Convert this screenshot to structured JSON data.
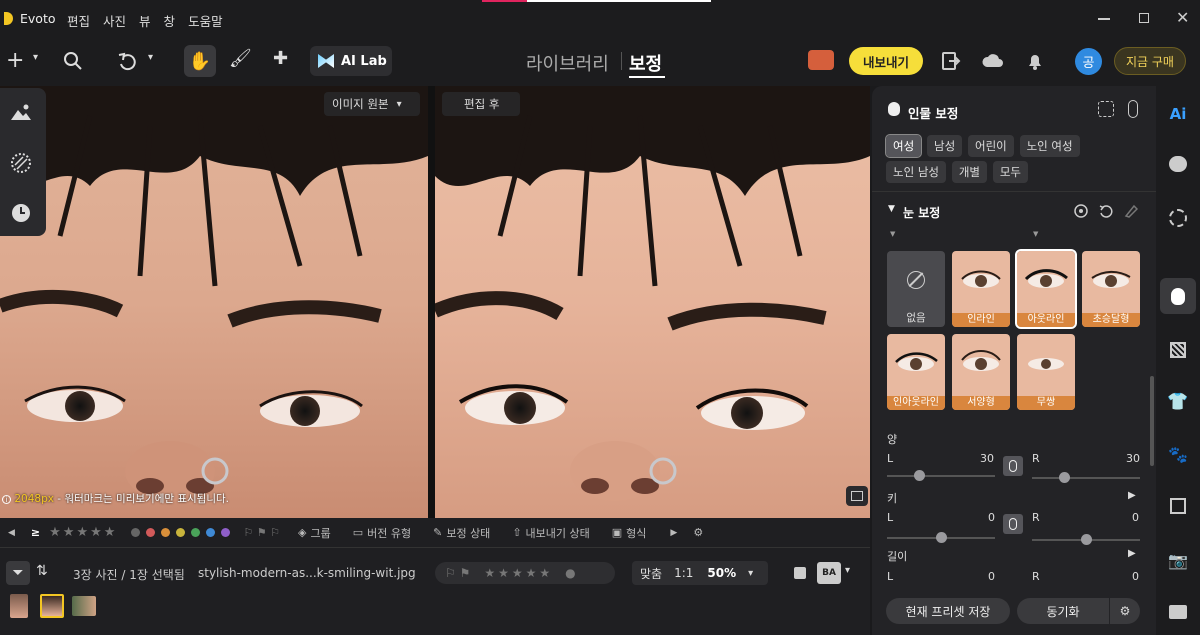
{
  "app": {
    "name": "Evoto",
    "menu": [
      "편집",
      "사진",
      "뷰",
      "창",
      "도움말"
    ]
  },
  "toolbar": {
    "ai_lab": "AI Lab",
    "tab_library": "라이브러리",
    "tab_edit": "보정",
    "export": "내보내기",
    "avatar": "공",
    "buy": "지금 구매"
  },
  "canvas": {
    "original_label": "이미지 원본",
    "after_label": "편집 후",
    "watermark_px": "2048px",
    "watermark_text": " - 워터마크는 미리보기에만 표시됩니다."
  },
  "filterbar": {
    "group": "그룹",
    "version": "버전 유형",
    "status": "보정 상태",
    "export_status": "내보내기 상태",
    "format": "형식",
    "colors": [
      "#d25a5a",
      "#d98f3a",
      "#c9b43c",
      "#4aa35a",
      "#3f8ad6",
      "#8f5fc9"
    ]
  },
  "statusbar": {
    "count": "3장 사진 / 1장 선택됨",
    "filename": "stylish-modern-as...k-smiling-wit.jpg",
    "fit": "맞춤",
    "ratio": "1:1",
    "zoom": "50%"
  },
  "panel": {
    "title": "인물 보정",
    "chips": [
      "여성",
      "남성",
      "어린이",
      "노인 여성",
      "노인 남성",
      "개별",
      "모두"
    ],
    "section": "눈 보정",
    "styles": [
      {
        "label": "없음",
        "none": true
      },
      {
        "label": "인라인"
      },
      {
        "label": "아웃라인",
        "selected": true
      },
      {
        "label": "초승달형"
      },
      {
        "label": "인아웃라인"
      },
      {
        "label": "서양형"
      },
      {
        "label": "무쌍"
      }
    ],
    "sliders": [
      {
        "name": "양",
        "L": "30",
        "R": "30",
        "Lval": 0.3,
        "Rval": 0.3,
        "linked": true
      },
      {
        "name": "키",
        "L": "0",
        "R": "0",
        "Lval": 0.5,
        "Rval": 0.5,
        "linked": true
      },
      {
        "name": "길이",
        "L": "0",
        "R": "0",
        "Lval": 0.5,
        "Rval": 0.5,
        "linked": true
      }
    ],
    "save_preset": "현재 프리셋 저장",
    "sync": "동기화"
  }
}
